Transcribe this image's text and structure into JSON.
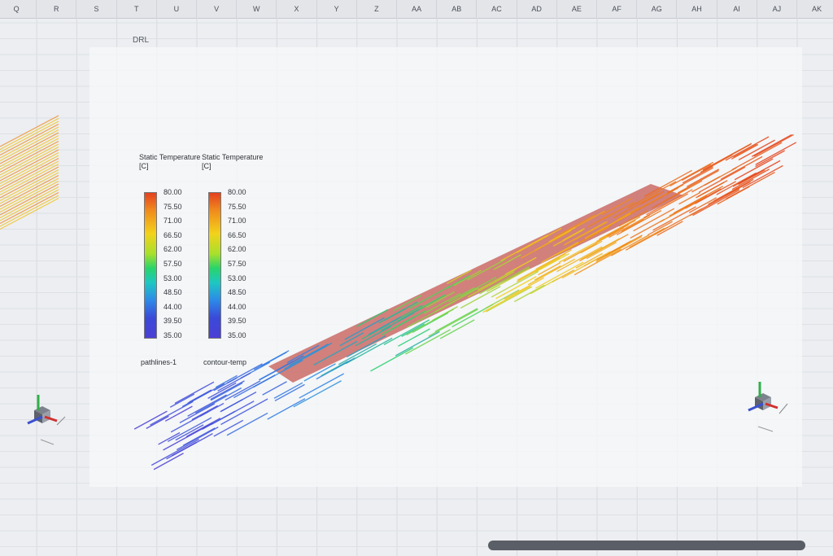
{
  "sheet": {
    "columns": [
      "Q",
      "R",
      "S",
      "T",
      "U",
      "V",
      "W",
      "X",
      "Y",
      "Z",
      "AA",
      "AB",
      "AC",
      "AD",
      "AE",
      "AF",
      "AG",
      "AH",
      "AI",
      "AJ",
      "AK"
    ],
    "cell_label": "DRL"
  },
  "legends": [
    {
      "title_line1": "Static Temperature",
      "title_line2": "[C]",
      "ticks": [
        "80.00",
        "75.50",
        "71.00",
        "66.50",
        "62.00",
        "57.50",
        "53.00",
        "48.50",
        "44.00",
        "39.50",
        "35.00"
      ],
      "name": "pathlines-1"
    },
    {
      "title_line1": "Static Temperature",
      "title_line2": "[C]",
      "ticks": [
        "80.00",
        "75.50",
        "71.00",
        "66.50",
        "62.00",
        "57.50",
        "53.00",
        "48.50",
        "44.00",
        "39.50",
        "35.00"
      ],
      "name": "contour-temp"
    }
  ],
  "colors": {
    "hot": "#e4411e",
    "warm": "#f3d21b",
    "mid": "#29d46a",
    "cool": "#2c8ae8",
    "cold": "#4b3fd6"
  }
}
